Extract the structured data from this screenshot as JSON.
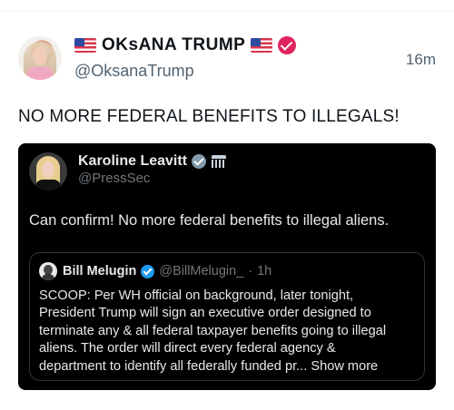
{
  "tweet": {
    "display_name": "OKsANA TRUMP",
    "handle": "@OksanaTrump",
    "time": "16m",
    "text": "NO MORE FEDERAL BENEFITS TO ILLEGALS!"
  },
  "quoted": {
    "display_name": "Karoline Leavitt",
    "handle": "@PressSec",
    "text": "Can confirm! No more federal benefits to illegal aliens.",
    "nested": {
      "display_name": "Bill Melugin",
      "handle": "@BillMelugin_",
      "separator": "·",
      "time": "1h",
      "lines": [
        "SCOOP: Per WH official on background, later tonight,",
        "President Trump will sign an executive order designed to",
        "terminate any & all federal taxpayer benefits going to illegal",
        "aliens. The order will direct every federal agency &",
        "department to identify all federally funded pr..."
      ],
      "show_more": "Show more"
    }
  },
  "colors": {
    "verified_badge": "#e0245e",
    "blue_check": "#1d9bf0",
    "grey_check": "#829aab",
    "card_background": "#000000"
  }
}
